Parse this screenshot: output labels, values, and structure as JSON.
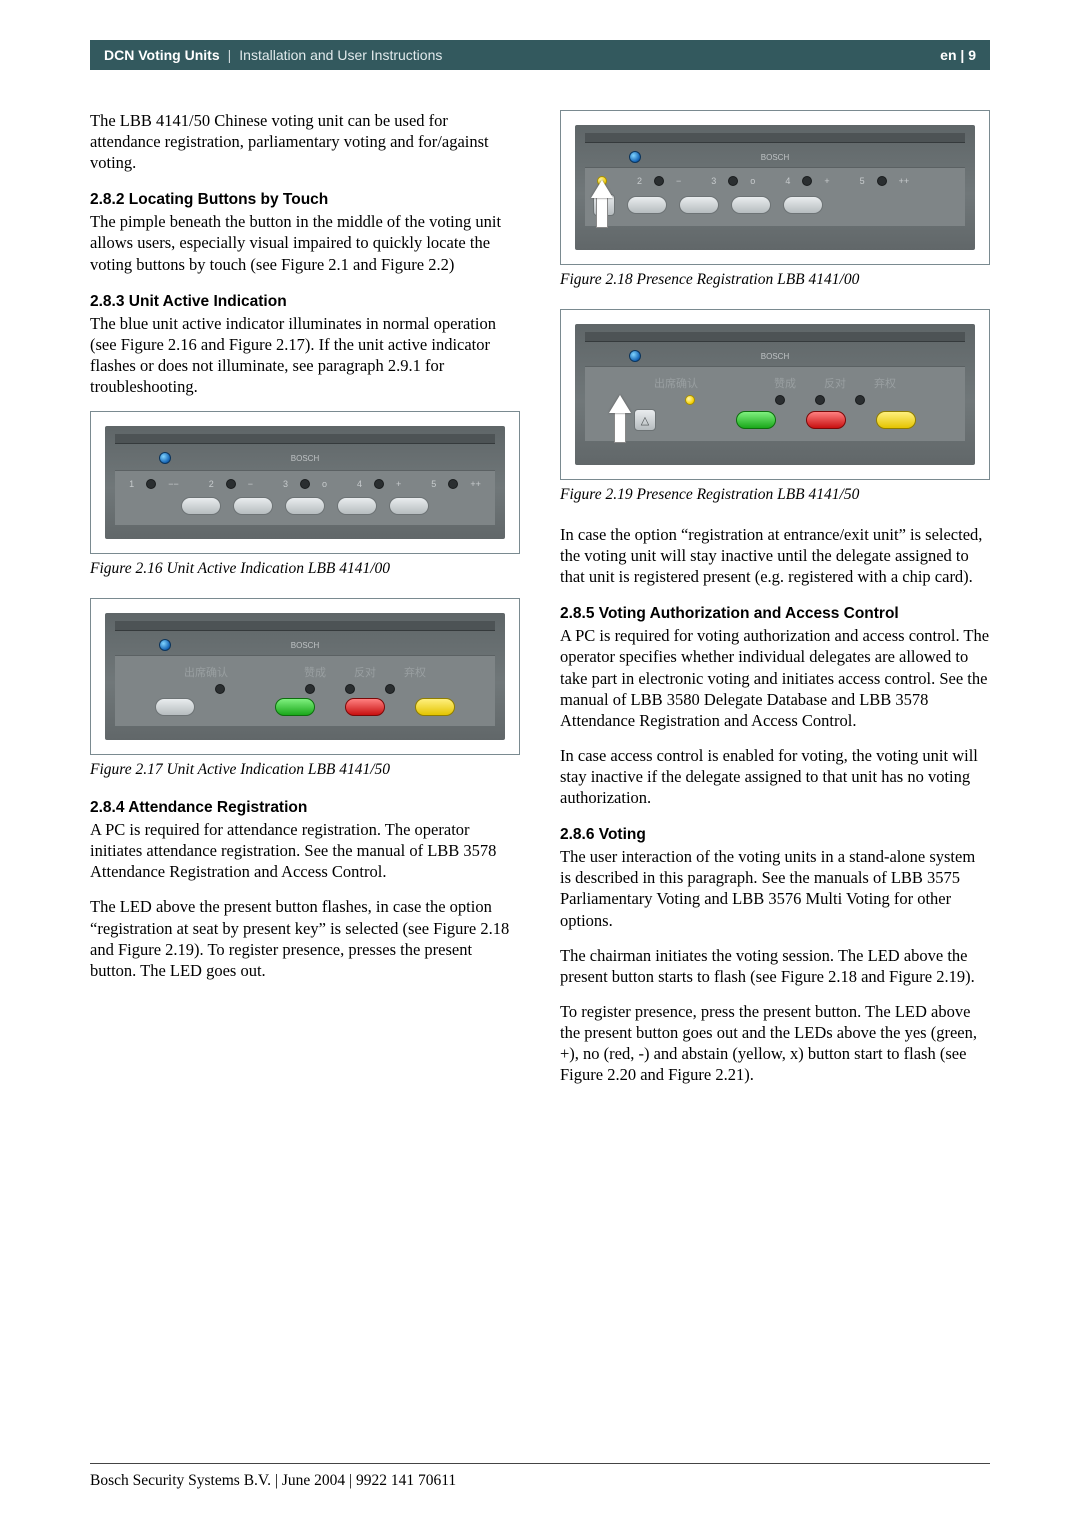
{
  "header": {
    "title_strong": "DCN Voting Units",
    "title_light": "Installation and User Instructions",
    "page_label": "en | 9"
  },
  "left": {
    "intro": "The LBB 4141/50 Chinese voting unit can be used for attendance registration, parliamentary voting and for/against voting.",
    "h282": "2.8.2  Locating Buttons by Touch",
    "p282": "The pimple beneath the button in the middle of the voting unit allows users, especially visual impaired to quickly locate the voting buttons by touch (see Figure 2.1 and Figure 2.2)",
    "h283": "2.8.3  Unit Active Indication",
    "p283": "The blue unit active indicator illuminates in normal operation (see Figure 2.16 and Figure 2.17). If the unit active indicator flashes or does not illuminate, see paragraph 2.9.1 for troubleshooting.",
    "cap216": "Figure 2.16 Unit Active Indication LBB 4141/00",
    "cap217": "Figure 2.17 Unit Active Indication LBB 4141/50",
    "h284": "2.8.4  Attendance Registration",
    "p284a": "A PC is required for attendance registration. The operator initiates attendance registration. See the manual of LBB 3578 Attendance Registration and Access Control.",
    "p284b": "The LED above the present button flashes, in case the option “registration at seat by present key” is selected (see Figure 2.18 and Figure 2.19). To register presence, presses the present button. The LED goes out."
  },
  "right": {
    "cap218": "Figure 2.18 Presence Registration LBB 4141/00",
    "cap219": "Figure 2.19 Presence Registration LBB 4141/50",
    "p_reg": "In case the option “registration at entrance/exit unit” is selected, the voting unit will stay inactive until the delegate assigned to that unit is registered present (e.g. registered with a chip card).",
    "h285": "2.8.5  Voting Authorization and Access Control",
    "p285a": "A PC is required for voting authorization and access control. The operator specifies whether individual delegates are allowed to take part in electronic voting and initiates access control. See the manual of LBB 3580 Delegate Database and LBB 3578 Attendance Registration and Access Control.",
    "p285b": "In case access control is enabled for voting, the voting unit will stay inactive if the delegate assigned to that unit has no voting authorization.",
    "h286": "2.8.6  Voting",
    "p286a": "The user interaction of the voting units in a stand-alone system is described in this paragraph. See the manuals of LBB 3575 Parliamentary Voting and LBB 3576 Multi Voting for other options.",
    "p286b": "The chairman initiates the voting session. The LED above the present button starts to flash (see Figure 2.18 and Figure 2.19).",
    "p286c": "To register presence, press the present button. The LED above the present button goes out and the LEDs above the yes (green, +), no (red, -) and abstain (yellow, x) button start to flash (see Figure 2.20 and Figure 2.21)."
  },
  "footer": "Bosch Security Systems B.V. | June 2004 | 9922 141 70611",
  "device_labels": {
    "brand": "BOSCH",
    "cn_present": "出席确认",
    "cn_yes": "赞成",
    "cn_no": "反对",
    "cn_abstain": "弃权",
    "sym_minusminus": "−−",
    "sym_minus": "−",
    "sym_o": "o",
    "sym_plus": "+",
    "sym_plusplus": "++"
  }
}
